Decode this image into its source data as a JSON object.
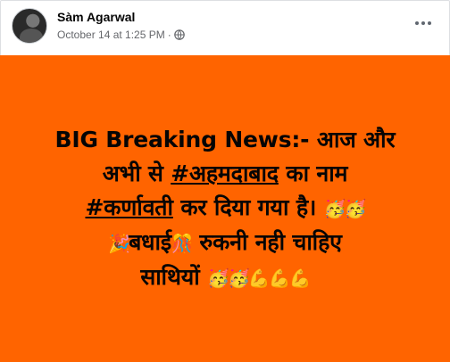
{
  "post": {
    "author": "Sàm Agarwal",
    "timestamp": "October 14 at 1:25 PM",
    "separator": "·",
    "privacy_icon": "globe-icon",
    "background_color": "#ff6400",
    "text": {
      "line1": "BIG Breaking News:- आज और",
      "line2_pre": "अभी से ",
      "hashtag1": "#अहमदाबाद",
      "line2_post": " का नाम",
      "hashtag2": "#कर्णावती",
      "line3_post": " कर दिया गया है। ",
      "emoji1": "🥳🥳",
      "emoji2": "🎉",
      "line4a": "बधाई",
      "emoji3": "🎊",
      "line4b": " रुकनी नही चाहिए",
      "line5": "साथियों ",
      "emoji4": "🥳🥳💪💪💪"
    }
  }
}
